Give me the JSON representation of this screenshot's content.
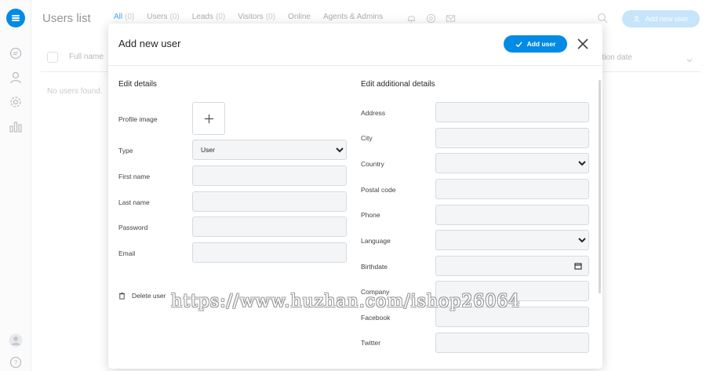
{
  "app": {
    "page_title": "Users list",
    "add_button_label": "Add new user"
  },
  "tabs": [
    {
      "label": "All",
      "count": "(0)"
    },
    {
      "label": "Users",
      "count": "(0)"
    },
    {
      "label": "Leads",
      "count": "(0)"
    },
    {
      "label": "Visitors",
      "count": "(0)"
    },
    {
      "label": "Online",
      "count": ""
    },
    {
      "label": "Agents & Admins",
      "count": ""
    }
  ],
  "table": {
    "columns": [
      "Full name",
      "ation date"
    ],
    "empty_text": "No users found."
  },
  "icons": {
    "logo": "chat-logo-icon",
    "rail": [
      "chat-icon",
      "user-icon",
      "gear-icon",
      "bar-chart-icon"
    ],
    "rail_bottom": [
      "avatar-icon",
      "help-icon"
    ]
  },
  "modal": {
    "title": "Add new user",
    "add_user_label": "Add user",
    "left_section": "Edit details",
    "right_section": "Edit additional details",
    "profile_image_label": "Profile image",
    "type_label": "Type",
    "type_value": "User",
    "first_name_label": "First name",
    "last_name_label": "Last name",
    "password_label": "Password",
    "email_label": "Email",
    "delete_user_label": "Delete user",
    "extra_fields": [
      "Address",
      "City",
      "Country",
      "Postal code",
      "Phone",
      "Language",
      "Birthdate",
      "Company",
      "Facebook",
      "Twitter"
    ]
  },
  "watermark": "https://www.huzhan.com/ishop26064",
  "colors": {
    "accent": "#028be5",
    "accent_light": "#b3dcf8"
  }
}
